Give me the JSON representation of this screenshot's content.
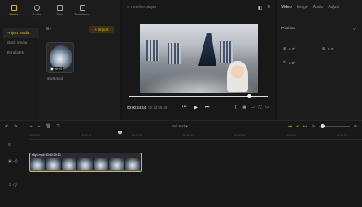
{
  "top_tools": [
    {
      "label": "Media",
      "icon": "media-icon",
      "active": true
    },
    {
      "label": "Audio",
      "icon": "audio-icon",
      "active": false
    },
    {
      "label": "Text",
      "icon": "text-icon",
      "active": false
    },
    {
      "label": "Transitions",
      "icon": "transitions-icon",
      "active": false
    }
  ],
  "media_sidebar": [
    "Project media",
    "Stock media",
    "Templates"
  ],
  "media_panel": {
    "view_toggle": "☰▾",
    "import_label": "+ Import",
    "item": {
      "badge": "▣ 00:20",
      "name": "s5y5.mp4"
    }
  },
  "player": {
    "title": "Timeline player",
    "time_current": "00:00:24:44",
    "time_total": "00:12:55:49"
  },
  "inspector": {
    "tabs": [
      "Video",
      "Image",
      "Audio",
      "Adjust"
    ],
    "active_tab": "Video",
    "section_label": "Position",
    "params": {
      "x": "0.0°",
      "y": "0.0°",
      "z": "0.0°"
    }
  },
  "timeline": {
    "center_label": "Full text ▾",
    "ticks": [
      "00:00:00",
      "00:00:10",
      "00:00:20",
      "00:00:30",
      "00:00:40",
      "00:00:50",
      "00:01:00",
      "00:01:10"
    ],
    "clip_label": "s5y5.mp4  00:00:39:10"
  },
  "colors": {
    "accent": "#e2b526",
    "background": "#141414",
    "panel": "#1c1c1c"
  }
}
